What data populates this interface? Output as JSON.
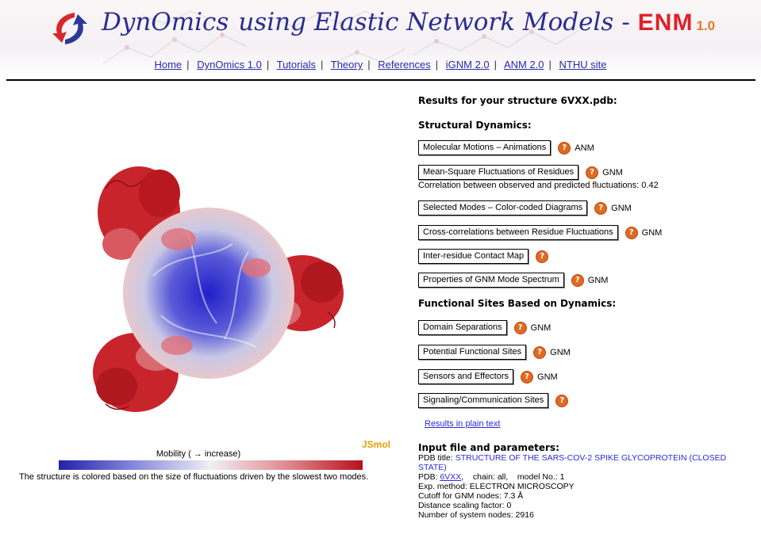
{
  "header": {
    "brand": "DynOmics",
    "subtitle": "using Elastic Network Models",
    "dash": "-",
    "enm": "ENM",
    "version": "1.0"
  },
  "nav": [
    "Home",
    "DynOmics 1.0",
    "Tutorials",
    "Theory",
    "References",
    "iGNM 2.0",
    "ANM 2.0",
    "NTHU site"
  ],
  "nav_separator": "|",
  "viewer": {
    "jsmol_label": "JSmol",
    "mobility_label": "Mobility ( → increase)",
    "caption": "The structure is colored based on the size of fluctuations driven by the slowest two modes."
  },
  "results": {
    "heading": "Results for your structure 6VXX.pdb:",
    "structural_heading": "Structural Dynamics:",
    "functional_heading": "Functional Sites Based on Dynamics:",
    "help_symbol": "?",
    "items": [
      {
        "label": "Molecular Motions – Animations",
        "tag": "ANM"
      },
      {
        "label": "Mean-Square Fluctuations of Residues",
        "tag": "GNM"
      },
      {
        "label": "Selected Modes – Color-coded Diagrams",
        "tag": "GNM"
      },
      {
        "label": "Cross-correlations between Residue Fluctuations",
        "tag": "GNM"
      },
      {
        "label": "Inter-residue Contact Map",
        "tag": ""
      },
      {
        "label": "Properties of GNM Mode Spectrum",
        "tag": "GNM"
      },
      {
        "label": "Domain Separations",
        "tag": "GNM"
      },
      {
        "label": "Potential Functional Sites",
        "tag": "GNM"
      },
      {
        "label": "Sensors and Effectors",
        "tag": "GNM"
      },
      {
        "label": "Signaling/Communication Sites",
        "tag": ""
      }
    ],
    "correlation_note": "Correlation between observed and predicted fluctuations: 0.42",
    "plain_text_link": "Results in plain text"
  },
  "params": {
    "heading": "Input file and parameters:",
    "pdb_title_label": "PDB title: ",
    "pdb_title": "STRUCTURE OF THE SARS-COV-2 SPIKE GLYCOPROTEIN (CLOSED STATE)",
    "pdb_label": "PDB: ",
    "pdb_id": "6VXX",
    "chain": ",    chain: all,    model No.: 1",
    "method": "Exp. method: ELECTRON MICROSCOPY",
    "cutoff": "Cutoff for GNM nodes: 7.3 Å",
    "scaling": "Distance scaling factor: 0",
    "nodes": "Number of system nodes: 2916"
  },
  "colors": {
    "title_blue": "#2a2d8f",
    "enm_red": "#e0202a",
    "link_blue": "#2a2ad8",
    "help_orange": "#e06a20",
    "mobility_low": "#2222aa",
    "mobility_high": "#b8101c"
  }
}
